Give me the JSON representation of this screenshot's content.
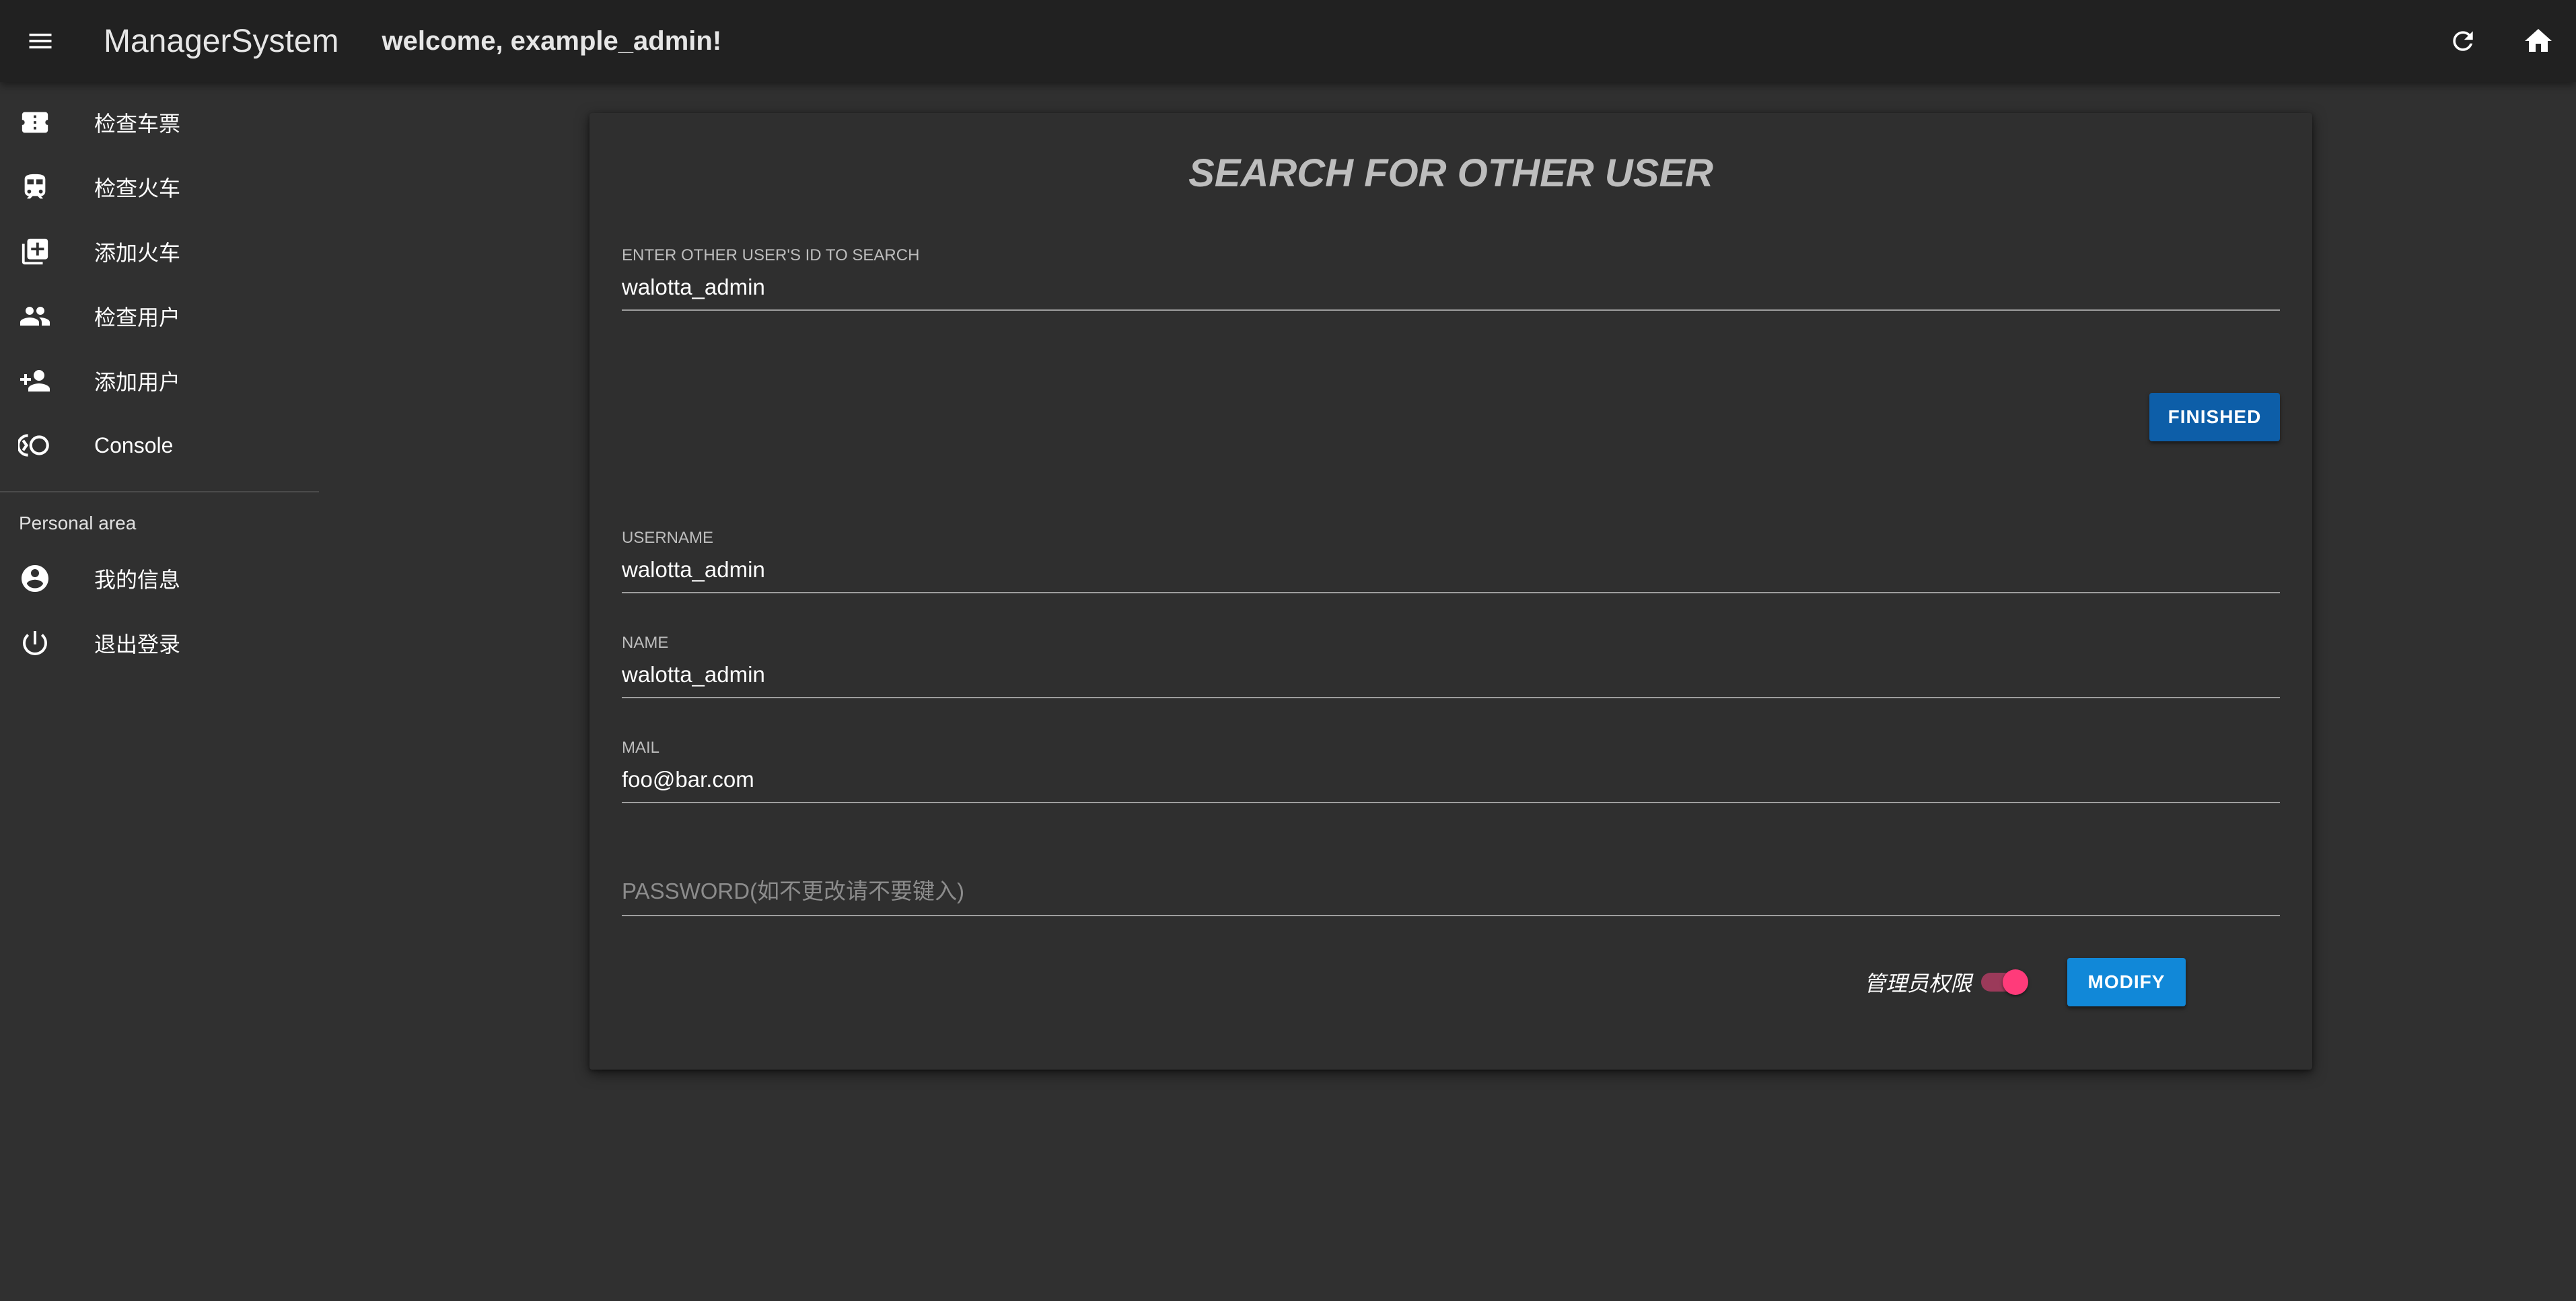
{
  "appbar": {
    "menu_icon": "menu-icon",
    "title": "ManagerSystem",
    "welcome": "welcome, example_admin!",
    "refresh_icon": "refresh-icon",
    "home_icon": "home-icon"
  },
  "sidebar": {
    "items": [
      {
        "label": "检查车票",
        "icon": "ticket-icon"
      },
      {
        "label": "检查火车",
        "icon": "train-icon"
      },
      {
        "label": "添加火车",
        "icon": "library-add-icon"
      },
      {
        "label": "检查用户",
        "icon": "people-icon"
      },
      {
        "label": "添加用户",
        "icon": "person-add-icon"
      },
      {
        "label": "Console",
        "icon": "console-icon"
      }
    ],
    "personal_header": "Personal area",
    "personal_items": [
      {
        "label": "我的信息",
        "icon": "account-circle-icon"
      },
      {
        "label": "退出登录",
        "icon": "power-icon"
      }
    ]
  },
  "card": {
    "title": "SEARCH FOR OTHER USER",
    "search": {
      "label": "ENTER OTHER USER'S ID TO SEARCH",
      "value": "walotta_admin"
    },
    "finished_label": "FINISHED",
    "username": {
      "label": "USERNAME",
      "value": "walotta_admin"
    },
    "name": {
      "label": "NAME",
      "value": "walotta_admin"
    },
    "mail": {
      "label": "MAIL",
      "value": "foo@bar.com"
    },
    "password": {
      "placeholder": "PASSWORD(如不更改请不要键入)"
    },
    "admin_toggle": {
      "label": "管理员权限",
      "checked": true
    },
    "modify_label": "MODIFY"
  },
  "colors": {
    "background": "#303030",
    "appbar": "#212121",
    "finished_button": "#0d5ea8",
    "modify_button": "#1188d8",
    "toggle_accent": "#ff3b7a"
  }
}
